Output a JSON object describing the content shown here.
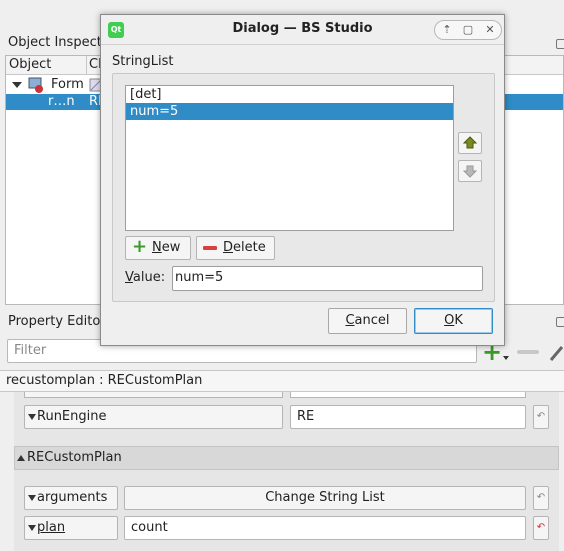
{
  "object_inspector": {
    "title": "Object Inspector",
    "columns": [
      "Object",
      "Class"
    ],
    "rows": [
      {
        "name": "Form",
        "class": ""
      },
      {
        "name": "r…n",
        "class": "RE"
      }
    ]
  },
  "property_editor": {
    "title": "Property Editor",
    "filter_placeholder": "Filter",
    "path": "recustomplan : RECustomPlan",
    "props": {
      "run_engine_label": "RunEngine",
      "run_engine_value": "RE",
      "group_label": "RECustomPlan",
      "arguments_label": "arguments",
      "arguments_value": "Change String List",
      "plan_label": "plan",
      "plan_value": "count"
    }
  },
  "dialog": {
    "title": "Dialog — BS Studio",
    "logo_text": "Qt",
    "group_title": "StringList",
    "items": [
      "[det]",
      "num=5"
    ],
    "selected_index": 1,
    "new_label_first": "N",
    "new_label_rest": "ew",
    "delete_label_first": "D",
    "delete_label_rest": "elete",
    "value_label_first": "V",
    "value_label_rest": "alue:",
    "value": "num=5",
    "cancel_label_first": "C",
    "cancel_label_rest": "ancel",
    "ok_label_first": "O",
    "ok_label_rest": "K"
  },
  "colors": {
    "selection": "#308cc6",
    "plus_green": "#3a9a2a",
    "delete_red": "#d94040"
  }
}
